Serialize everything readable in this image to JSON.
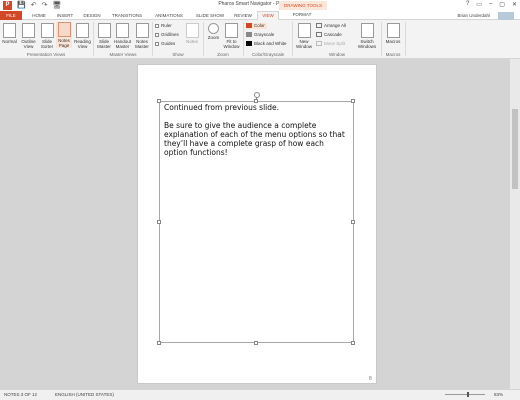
{
  "window": {
    "title": "Pharos Smart Navigator - PowerPoint",
    "logo_letter": "P",
    "controls": [
      "?",
      "▭",
      "–",
      "▢",
      "✕"
    ]
  },
  "qat": {
    "save": "💾",
    "undo": "↶",
    "redo": "↷",
    "start": "🖥"
  },
  "contextual_tab_group": "DRAWING TOOLS",
  "tabs": {
    "file": "FILE",
    "home": "HOME",
    "insert": "INSERT",
    "design": "DESIGN",
    "transitions": "TRANSITIONS",
    "animations": "ANIMATIONS",
    "slideshow": "SLIDE SHOW",
    "review": "REVIEW",
    "view": "VIEW",
    "format": "FORMAT"
  },
  "user": {
    "name": "Brian Underdahl"
  },
  "ribbon": {
    "normal": "Normal",
    "outline": "Outline View",
    "slide_sorter": "Slide Sorter",
    "notes_page": "Notes Page",
    "reading": "Reading View",
    "slide_master": "Slide Master",
    "handout_master": "Handout Master",
    "notes_master": "Notes Master",
    "ruler": "Ruler",
    "gridlines": "Gridlines",
    "guides": "Guides",
    "notes": "Notes",
    "zoom": "Zoom",
    "fit": "Fit to Window",
    "color": "Color",
    "grayscale": "Grayscale",
    "bw": "Black and White",
    "new_window": "New Window",
    "arrange_all": "Arrange All",
    "cascade": "Cascade",
    "move_split": "Move Split",
    "switch_windows": "Switch Windows",
    "macros": "Macros",
    "groups": {
      "presentation_views": "Presentation Views",
      "master_views": "Master Views",
      "show": "Show",
      "zoom": "Zoom",
      "color": "Color/Grayscale",
      "window": "Window",
      "macros": "Macros"
    }
  },
  "notes_page": {
    "paragraphs": [
      "Continued from previous slide.",
      "Be sure to give the audience a complete explanation of each of the menu options so that they’ll have a complete grasp of how each option functions!"
    ],
    "page_number": "8"
  },
  "status": {
    "notes": "NOTES 3 OF 12",
    "language": "ENGLISH (UNITED STATES)",
    "zoom": "83%"
  },
  "colors": {
    "accent": "#d24726",
    "ribbon_bg": "#f3f3f3",
    "canvas_bg": "#d4d4d4"
  }
}
